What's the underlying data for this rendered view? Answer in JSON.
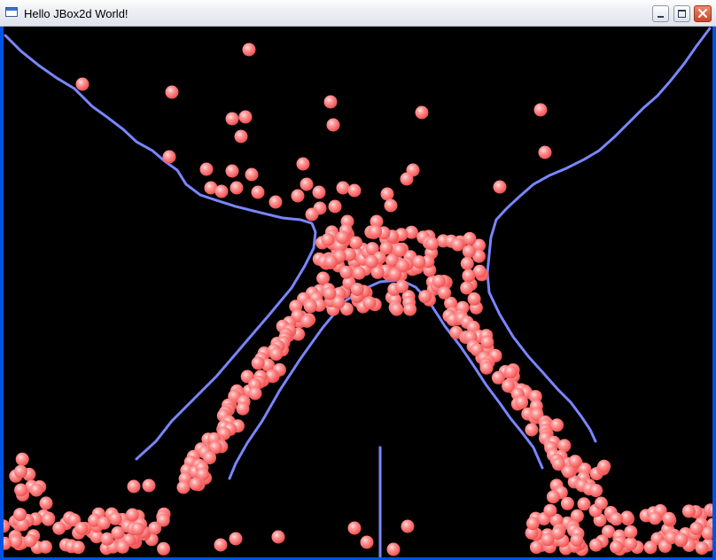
{
  "window": {
    "title": "Hello JBox2d World!",
    "icon": "window-icon",
    "controls": [
      {
        "name": "minimize-button",
        "icon": "minimize-icon"
      },
      {
        "name": "maximize-button",
        "icon": "maximize-icon"
      },
      {
        "name": "close-button",
        "icon": "close-icon"
      }
    ]
  },
  "colors": {
    "titlebar": "#eef0f5",
    "client_background": "#000000",
    "ball": "#ff6f6f",
    "ball_highlight": "#ffe0e0",
    "ground": "#7a86ff"
  }
}
